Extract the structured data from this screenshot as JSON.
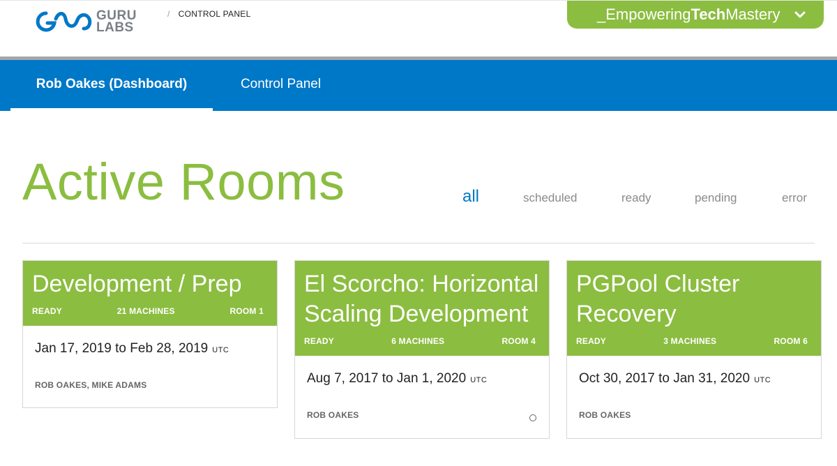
{
  "header": {
    "logo_line1": "GURU",
    "logo_line2": "LABS",
    "breadcrumb_sep": "/",
    "breadcrumb": "CONTROL PANEL",
    "brand_prefix": "_Empowering",
    "brand_bold": "Tech",
    "brand_suffix": "Mastery"
  },
  "nav": {
    "tabs": [
      {
        "label": "Rob Oakes (Dashboard)",
        "active": true
      },
      {
        "label": "Control Panel",
        "active": false
      }
    ]
  },
  "main": {
    "title": "Active Rooms",
    "filters": [
      {
        "label": "all",
        "active": true
      },
      {
        "label": "scheduled",
        "active": false
      },
      {
        "label": "ready",
        "active": false
      },
      {
        "label": "pending",
        "active": false
      },
      {
        "label": "error",
        "active": false
      }
    ]
  },
  "rooms": [
    {
      "title": "Development / Prep",
      "status": "READY",
      "machines": "21 MACHINES",
      "room": "ROOM 1",
      "dates": "Jan 17, 2019 to Feb 28, 2019",
      "tz": "UTC",
      "people": "ROB OAKES, MIKE ADAMS"
    },
    {
      "title": "El Scorcho: Horizontal Scaling Development",
      "status": "READY",
      "machines": "6 MACHINES",
      "room": "ROOM 4",
      "dates": "Aug 7, 2017 to Jan 1, 2020",
      "tz": "UTC",
      "people": "ROB OAKES"
    },
    {
      "title": "PGPool Cluster Recovery",
      "status": "READY",
      "machines": "3 MACHINES",
      "room": "ROOM 6",
      "dates": "Oct 30, 2017 to Jan 31, 2020",
      "tz": "UTC",
      "people": "ROB OAKES"
    }
  ],
  "colors": {
    "brand_green": "#8bbd40",
    "nav_blue": "#0078c8"
  }
}
